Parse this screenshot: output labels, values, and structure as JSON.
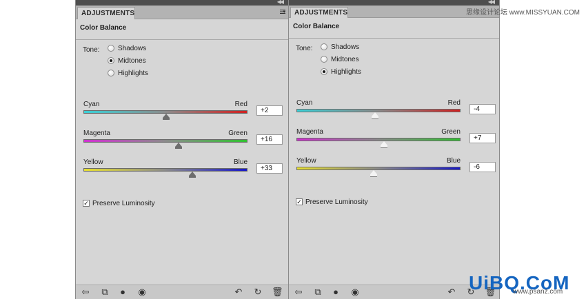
{
  "watermark": {
    "top_text": "思缘设计论坛 www.MISSYUAN.COM",
    "logo": "UiBQ.CoM",
    "url": "www.psanz.com"
  },
  "panels": [
    {
      "tab": "ADJUSTMENTS",
      "title": "Color Balance",
      "tone_label": "Tone:",
      "tones": [
        {
          "label": "Shadows",
          "selected": false
        },
        {
          "label": "Midtones",
          "selected": true
        },
        {
          "label": "Highlights",
          "selected": false
        }
      ],
      "sliders": [
        {
          "left": "Cyan",
          "right": "Red",
          "value": "+2",
          "pct": 0.505,
          "colors": [
            "#3ad0d6",
            "#d02020"
          ]
        },
        {
          "left": "Magenta",
          "right": "Green",
          "value": "+16",
          "pct": 0.58,
          "colors": [
            "#d030d0",
            "#30c030"
          ]
        },
        {
          "left": "Yellow",
          "right": "Blue",
          "value": "+33",
          "pct": 0.665,
          "colors": [
            "#e8e030",
            "#1818c8"
          ]
        }
      ],
      "preserve_luminosity": "Preserve Luminosity",
      "thumb_style": "gray"
    },
    {
      "tab": "ADJUSTMENTS",
      "title": "Color Balance",
      "tone_label": "Tone:",
      "tones": [
        {
          "label": "Shadows",
          "selected": false
        },
        {
          "label": "Midtones",
          "selected": false
        },
        {
          "label": "Highlights",
          "selected": true
        }
      ],
      "sliders": [
        {
          "left": "Cyan",
          "right": "Red",
          "value": "-4",
          "pct": 0.48,
          "colors": [
            "#3ad0d6",
            "#d02020"
          ]
        },
        {
          "left": "Magenta",
          "right": "Green",
          "value": "+7",
          "pct": 0.535,
          "colors": [
            "#d030d0",
            "#30c030"
          ]
        },
        {
          "left": "Yellow",
          "right": "Blue",
          "value": "-6",
          "pct": 0.47,
          "colors": [
            "#e8e030",
            "#1818c8"
          ]
        }
      ],
      "preserve_luminosity": "Preserve Luminosity",
      "thumb_style": "white"
    }
  ]
}
